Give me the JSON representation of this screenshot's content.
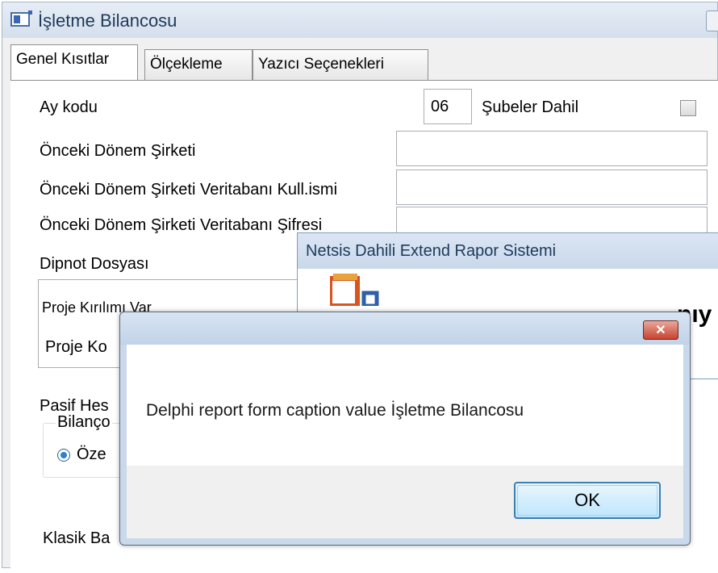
{
  "window": {
    "title": "İşletme Bilancosu",
    "tabs": [
      {
        "label": "Genel Kısıtlar",
        "active": true
      },
      {
        "label": "Ölçekleme",
        "active": false
      },
      {
        "label": "Yazıcı Seçenekleri",
        "active": false
      }
    ]
  },
  "form": {
    "ay_kodu_label": "Ay kodu",
    "ay_kodu_value": "06",
    "subeler_label": "Şubeler Dahil",
    "subeler_checked": false,
    "onceki_sirket_label": "Önceki Dönem Şirketi",
    "onceki_kull_label": "Önceki Dönem Şirketi Veritabanı Kull.ismi",
    "onceki_sifre_label": "Önceki Dönem Şirketi Veritabanı Şifresi",
    "dipnot_label": "Dipnot Dosyası",
    "proje_kirilim_label": "Proje Kırılımı Var",
    "proje_kodu_label": "Proje Ko",
    "pasif_label": "Pasif Hes",
    "bilanco_label": "Bilanço",
    "ozet_label": "Öze",
    "klasik_label": "Klasik Ba"
  },
  "background_window": {
    "title": "Netsis Dahili Extend  Rapor Sistemi",
    "partial_text": "nıy"
  },
  "dialog": {
    "message": "Delphi report form caption value İşletme Bilancosu",
    "ok_label": "OK"
  },
  "colors": {
    "title_text": "#1e395b",
    "close_red": "#c7422e",
    "ok_border": "#3c7fb1"
  }
}
